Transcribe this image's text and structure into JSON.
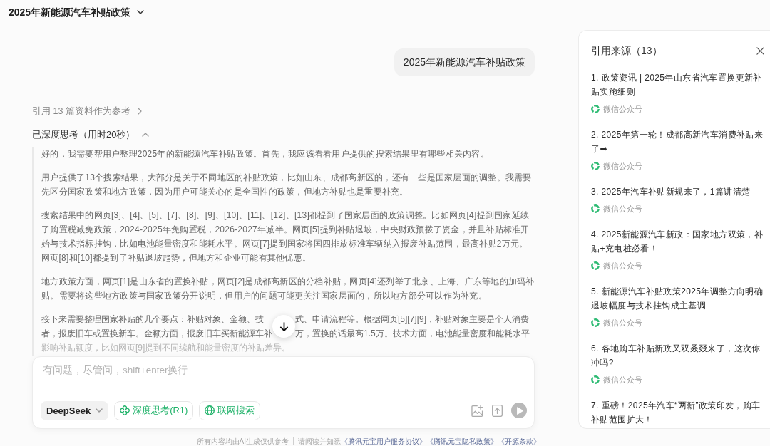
{
  "header": {
    "title": "2025年新能源汽车补贴政策"
  },
  "conversation": {
    "user_message": "2025年新能源汽车补贴政策",
    "references_link": "引用 13 篇资料作为参考",
    "thinking": {
      "label": "已深度思考（用时20秒）",
      "expanded": true,
      "paragraphs": [
        "好的，我需要帮用户整理2025年的新能源汽车补贴政策。首先，我应该看看用户提供的搜索结果里有哪些相关内容。",
        "用户提供了13个搜索结果，大部分是关于不同地区的补贴政策，比如山东、成都高新区的，还有一些是国家层面的调整。我需要先区分国家政策和地方政策，因为用户可能关心的是全国性的政策，但地方补贴也是重要补充。",
        "搜索结果中的网页[3]、[4]、[5]、[7]、[8]、[9]、[10]、[11]、[12]、[13]都提到了国家层面的政策调整。比如网页[4]提到国家延续了购置税减免政策，2024-2025年免购置税，2026-2027年减半。网页[5]提到补贴退坡，中央财政预拨了资金，并且补贴标准开始与技术指标挂钩，比如电池能量密度和能耗水平。网页[7]提到国家将国四排放标准车辆纳入报废补贴范围，最高补贴2万元。网页[8]和[10]都提到了补贴退坡趋势，但地方和企业可能有其他优惠。",
        "地方政策方面，网页[1]是山东省的置换补贴，网页[2]是成都高新区的分档补贴，网页[4]还列举了北京、上海、广东等地的加码补贴。需要将这些地方政策与国家政策分开说明，但用户的问题可能更关注国家层面的，所以地方部分可以作为补充。"
      ],
      "covered_paragraph": [
        [
          "接下来需要整理国家补贴的几个要点：补贴对象、金额、技",
          "式、申请流程等。根据网页[5][7][9]，补贴对象主要是个人消费"
        ],
        [
          "者，报废旧车或置换新车。金额方面，报废旧车买新能源车补",
          "万，置换的话最高1.5万。技术方面，电池能量密度和能耗水平"
        ],
        [
          "影响补贴额度，比如网页[9]提到不同续航和能量密度的补贴差异。"
        ]
      ]
    }
  },
  "composer": {
    "placeholder": "有问题，尽管问，shift+enter换行",
    "model": "DeepSeek",
    "toggles": [
      {
        "kind": "deep-think",
        "label": "深度思考(R1)",
        "on": true
      },
      {
        "kind": "web-search",
        "label": "联网搜索",
        "on": true
      }
    ],
    "send": {
      "disabled": true
    }
  },
  "footer": {
    "notice": "所有内容均由AI生成仅供参考",
    "prompt": "请阅读并知悉",
    "links": [
      "《腾讯元宝用户服务协议》",
      "《腾讯元宝隐私政策》",
      "《开源条款》"
    ]
  },
  "sources_panel": {
    "title": "引用来源（13）",
    "items": [
      {
        "title": "1. 政策资讯 | 2025年山东省汽车置换更新补贴实施细则",
        "source": "微信公众号"
      },
      {
        "title": "2. 2025年第一轮！成都高新汽车消费补贴来了➡",
        "source": "微信公众号"
      },
      {
        "title": "3. 2025年汽车补贴新规来了，1篇讲清楚",
        "source": "微信公众号"
      },
      {
        "title": "4. 2025新能源汽车新政：国家地方双策，补贴+充电桩必看！",
        "source": "微信公众号"
      },
      {
        "title": "5. 新能源汽车补贴政策2025年调整方向明确退坡幅度与技术挂钩成主基调",
        "source": "微信公众号"
      },
      {
        "title": "6. 各地购车补贴新政又双叒叕来了，这次你冲吗?",
        "source": "微信公众号"
      },
      {
        "title": "7. 重磅！2025年汽车“两新”政策印发，购车补贴范围扩大！"
      }
    ]
  }
}
